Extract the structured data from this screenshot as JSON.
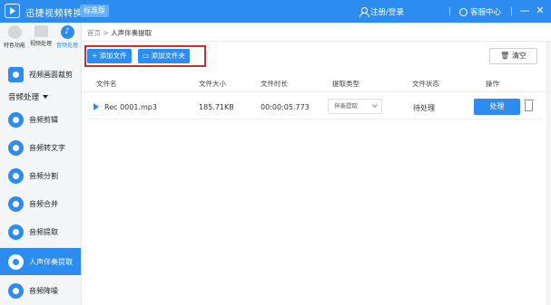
{
  "titlebar": {
    "app_title": "迅捷视频转换器",
    "edition": "标准版",
    "login": "注册/登录",
    "service": "客服中心",
    "minimize": "—",
    "close": "✕"
  },
  "topnav": {
    "items": [
      {
        "label": "特色功能"
      },
      {
        "label": "视频处理"
      },
      {
        "label": "音频处理",
        "active": true
      }
    ]
  },
  "sidebar": {
    "video_item": "视频画面裁剪",
    "group_label": "音频处理",
    "items": [
      {
        "label": "音频剪辑"
      },
      {
        "label": "音频转文字"
      },
      {
        "label": "音频分割"
      },
      {
        "label": "音频合并"
      },
      {
        "label": "音频提取"
      },
      {
        "label": "人声伴奏提取",
        "active": true
      },
      {
        "label": "音频降噪"
      }
    ]
  },
  "breadcrumb": {
    "home": "首页",
    "separator": ">",
    "current": "人声伴奏提取"
  },
  "toolbar": {
    "add_file": "+ 添加文件",
    "add_folder": "添加文件夹",
    "clear": "清空"
  },
  "table": {
    "headers": [
      "文件名",
      "文件大小",
      "文件时长",
      "提取类型",
      "文件状态",
      "操作"
    ],
    "rows": [
      {
        "filename": "Rec 0001.mp3",
        "size": "185.71KB",
        "duration": "00:00:05.773",
        "extract_type": "伴奏提取",
        "status": "待处理",
        "action": "处理"
      }
    ]
  },
  "colors": {
    "accent": "#2d8cf0",
    "highlight_border": "#c9302c"
  }
}
